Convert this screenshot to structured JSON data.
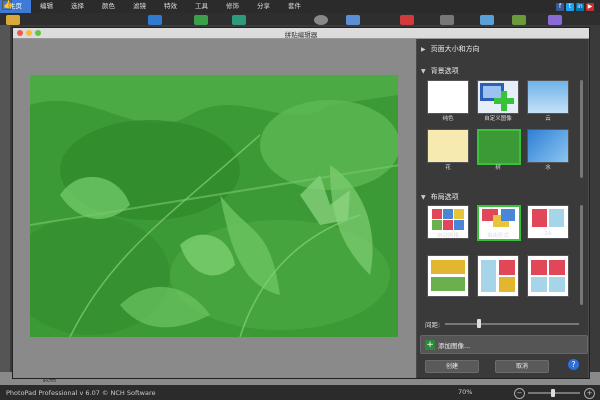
{
  "menubar": {
    "tabs": [
      "主页",
      "编辑",
      "选择",
      "颜色",
      "滤镜",
      "特效",
      "工具",
      "修饰",
      "分享",
      "套件"
    ],
    "active_index": 0,
    "social_icons": [
      "thumbs-up-icon",
      "facebook-icon",
      "twitter-icon",
      "linkedin-icon",
      "youtube-icon"
    ]
  },
  "dialog": {
    "title": "拼贴编辑器",
    "sections": {
      "page_size": "页面大小和方向",
      "background": "背景选项",
      "layout": "布局选项"
    },
    "background_options": [
      {
        "label": "纯色",
        "thumb": "solid-white"
      },
      {
        "label": "自定义图像",
        "thumb": "custom-image"
      },
      {
        "label": "云",
        "thumb": "cloud"
      },
      {
        "label": "花",
        "thumb": "flower"
      },
      {
        "label": "树",
        "thumb": "leaf",
        "selected": true
      },
      {
        "label": "水",
        "thumb": "water"
      }
    ],
    "layout_options": [
      {
        "label": "自动网格",
        "thumb": "auto-grid"
      },
      {
        "label": "自由形式",
        "thumb": "free-form",
        "selected": true
      },
      {
        "label": "2A",
        "thumb": "2a"
      },
      {
        "label": "",
        "thumb": "layout-4"
      },
      {
        "label": "",
        "thumb": "layout-5"
      },
      {
        "label": "",
        "thumb": "layout-6"
      }
    ],
    "spacing_label": "间距:",
    "add_image": "添加图像...",
    "create": "创建",
    "cancel": "取消",
    "help": "?"
  },
  "app": {
    "bottom_tag": "假期"
  },
  "status": {
    "version": "PhotoPad Professional v 6.07 © NCH Software",
    "zoom": "70%",
    "zoom_out": "−",
    "zoom_in": "+"
  },
  "colors": {
    "accent": "#3d7bd6",
    "selection": "#37c23a",
    "photo_green": "#3c9a36"
  }
}
